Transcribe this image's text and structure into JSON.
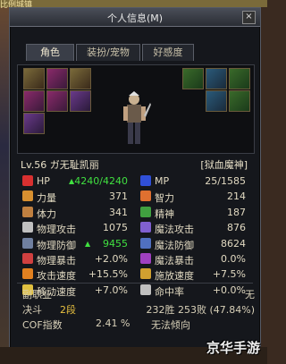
{
  "window": {
    "title": "个人信息(M)",
    "close": "×"
  },
  "bg": {
    "top_text": "比例城镇"
  },
  "tabs": [
    {
      "label": "角色",
      "active": true
    },
    {
      "label": "装扮/宠物",
      "active": false
    },
    {
      "label": "好感度",
      "active": false
    }
  ],
  "header": {
    "level": "Lv.56",
    "name": "ガ无耻凯丽",
    "job": "[狱血魔神]"
  },
  "stats": [
    {
      "left": {
        "icon": "hp-icon",
        "color": "#d83030",
        "label": "HP",
        "value": "4240/4240",
        "arrow": "▲",
        "green": true
      },
      "right": {
        "icon": "mp-icon",
        "color": "#3050d8",
        "label": "MP",
        "value": "25/1585",
        "green": false
      }
    },
    {
      "left": {
        "icon": "strength-icon",
        "color": "#d89030",
        "label": "力量",
        "value": "371"
      },
      "right": {
        "icon": "intelligence-icon",
        "color": "#e07030",
        "label": "智力",
        "value": "214"
      }
    },
    {
      "left": {
        "icon": "vitality-icon",
        "color": "#c08040",
        "label": "体力",
        "value": "341"
      },
      "right": {
        "icon": "spirit-icon",
        "color": "#40a040",
        "label": "精神",
        "value": "187"
      }
    },
    {
      "left": {
        "icon": "physical-attack-icon",
        "color": "#c0c0c0",
        "label": "物理攻击",
        "value": "1075"
      },
      "right": {
        "icon": "magic-attack-icon",
        "color": "#8060d0",
        "label": "魔法攻击",
        "value": "876"
      }
    },
    {
      "left": {
        "icon": "physical-defense-icon",
        "color": "#7080a0",
        "label": "物理防御",
        "value": "9455",
        "arrow": "▲",
        "green": true
      },
      "right": {
        "icon": "magic-defense-icon",
        "color": "#5070c0",
        "label": "魔法防御",
        "value": "8624"
      }
    },
    {
      "left": {
        "icon": "physical-crit-icon",
        "color": "#d04040",
        "label": "物理暴击",
        "value": "+2.0%"
      },
      "right": {
        "icon": "magic-crit-icon",
        "color": "#a040c0",
        "label": "魔法暴击",
        "value": "0.0%"
      }
    },
    {
      "left": {
        "icon": "attack-speed-icon",
        "color": "#e08020",
        "label": "攻击速度",
        "value": "+15.5%"
      },
      "right": {
        "icon": "cast-speed-icon",
        "color": "#d0a030",
        "label": "施放速度",
        "value": "+7.5%"
      }
    },
    {
      "left": {
        "icon": "move-speed-icon",
        "color": "#e0c040",
        "label": "移动速度",
        "value": "+7.0%"
      },
      "right": {
        "icon": "hit-rate-icon",
        "color": "#c0c0c0",
        "label": "命中率",
        "value": "+0.0%"
      }
    }
  ],
  "bottom": {
    "subjob_label": "副职业",
    "subjob_value": "无",
    "duel_label": "决斗",
    "duel_rank": "2段",
    "duel_record": "232胜 253败 (47.84%)",
    "cof_label": "COF指数",
    "cof_value": "2.41 %",
    "tendency": "无法倾向"
  },
  "watermark": "京华手游"
}
